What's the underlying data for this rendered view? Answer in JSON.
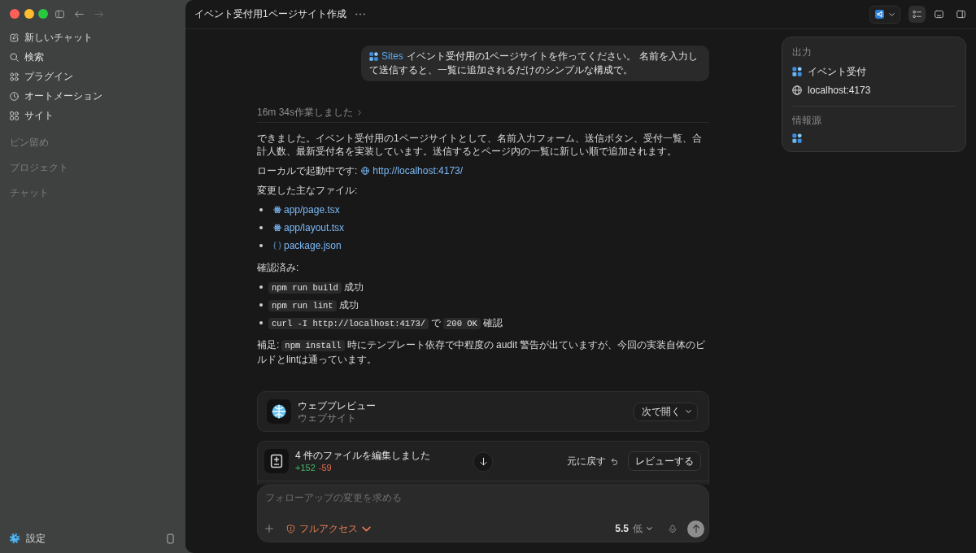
{
  "window": {
    "traffic_lights": [
      {
        "color": "#ff5f57"
      },
      {
        "color": "#febc2e"
      },
      {
        "color": "#28c840"
      }
    ],
    "history": [
      {
        "kind": "back",
        "disabled": false
      },
      {
        "kind": "forward",
        "disabled": true
      }
    ]
  },
  "sidebar": {
    "nav": [
      {
        "kind": "new-chat",
        "label": "新しいチャット"
      },
      {
        "kind": "search",
        "label": "検索"
      },
      {
        "kind": "plugins",
        "label": "プラグイン"
      },
      {
        "kind": "automations",
        "label": "オートメーション"
      },
      {
        "kind": "sites",
        "label": "サイト"
      }
    ],
    "sections": [
      "ピン留め",
      "プロジェクト",
      "チャット"
    ],
    "settings": "設定"
  },
  "header": {
    "title": "イベント受付用1ページサイト作成",
    "tools": [
      {
        "kind": "editor",
        "selected": false
      },
      {
        "kind": "checklist",
        "selected": true
      },
      {
        "kind": "terminal",
        "selected": false
      },
      {
        "kind": "side-panel",
        "selected": false
      }
    ]
  },
  "user_message": {
    "tag": "Sites",
    "text": "イベント受付用の1ページサイトを作ってください。 名前を入力して送信すると、一覧に追加されるだけのシンプルな構成で。"
  },
  "output_panel": {
    "title": "出力",
    "items": [
      {
        "kind": "site",
        "label": "イベント受付"
      },
      {
        "kind": "url",
        "label": "localhost:4173"
      }
    ],
    "sources_title": "情報源",
    "sources": [
      {
        "kind": "site"
      }
    ]
  },
  "response": {
    "worked": "16m 34s作業しました",
    "summary": "できました。イベント受付用の1ページサイトとして、名前入力フォーム、送信ボタン、受付一覧、合計人数、最新受付名を実装しています。送信するとページ内の一覧に新しい順で追加されます。",
    "server": {
      "label": "ローカルで起動中です:",
      "url": "http://localhost:4173/"
    },
    "files_heading": "変更した主なファイル:",
    "files": [
      {
        "kind": "react",
        "name": "app/page.tsx"
      },
      {
        "kind": "react",
        "name": "app/layout.tsx"
      },
      {
        "kind": "json",
        "name": "package.json"
      }
    ],
    "checks_heading": "確認済み:",
    "checks": [
      {
        "parts": [
          {
            "kind": "code",
            "text": "npm run build"
          },
          {
            "kind": "text",
            "text": "成功"
          }
        ]
      },
      {
        "parts": [
          {
            "kind": "code",
            "text": "npm run lint"
          },
          {
            "kind": "text",
            "text": "成功"
          }
        ]
      },
      {
        "parts": [
          {
            "kind": "code",
            "text": "curl -I http://localhost:4173/"
          },
          {
            "kind": "text",
            "text": "で"
          },
          {
            "kind": "code",
            "text": "200 OK"
          },
          {
            "kind": "text",
            "text": "確認"
          }
        ]
      }
    ],
    "note": [
      {
        "kind": "text",
        "text": "補足:"
      },
      {
        "kind": "code",
        "text": "npm install"
      },
      {
        "kind": "text",
        "text": "時にテンプレート依存で中程度の audit 警告が出ていますが、今回の実装自体のビルドとlintは通っています。"
      }
    ]
  },
  "preview_card": {
    "title": "ウェブプレビュー",
    "subtitle": "ウェブサイト",
    "open_with": "次で開く"
  },
  "edit_card": {
    "title": "4 件のファイルを編集しました",
    "added": "+152",
    "removed": "-59",
    "undo": "元に戻す",
    "review": "レビューする"
  },
  "composer": {
    "placeholder": "フォローアップの変更を求める",
    "access": "フルアクセス",
    "model": "5.5",
    "effort": "低"
  }
}
